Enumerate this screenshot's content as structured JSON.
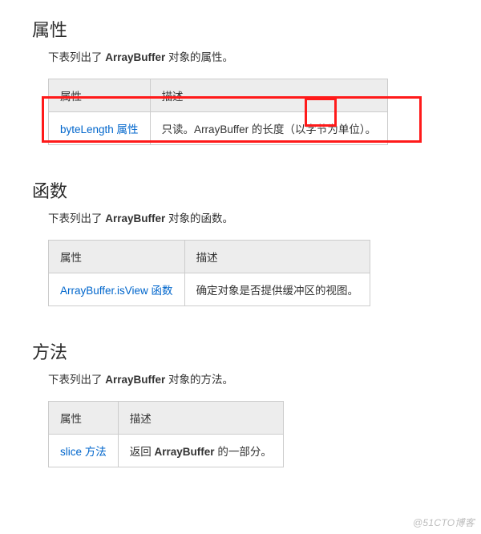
{
  "sections": {
    "properties": {
      "heading": "属性",
      "desc_prefix": "下表列出了 ",
      "desc_bold": "ArrayBuffer",
      "desc_suffix": " 对象的属性。",
      "table": {
        "headers": {
          "col1": "属性",
          "col2": "描述"
        },
        "row": {
          "name": "byteLength 属性",
          "desc": "只读。ArrayBuffer 的长度（以字节为单位）。"
        }
      }
    },
    "functions": {
      "heading": "函数",
      "desc_prefix": "下表列出了 ",
      "desc_bold": "ArrayBuffer",
      "desc_suffix": " 对象的函数。",
      "table": {
        "headers": {
          "col1": "属性",
          "col2": "描述"
        },
        "row": {
          "name": "ArrayBuffer.isView 函数",
          "desc": "确定对象是否提供缓冲区的视图。"
        }
      }
    },
    "methods": {
      "heading": "方法",
      "desc_prefix": "下表列出了 ",
      "desc_bold": "ArrayBuffer",
      "desc_suffix": " 对象的方法。",
      "table": {
        "headers": {
          "col1": "属性",
          "col2": "描述"
        },
        "row": {
          "name": "slice 方法",
          "desc_prefix": "返回 ",
          "desc_bold": "ArrayBuffer",
          "desc_suffix": " 的一部分。"
        }
      }
    }
  },
  "watermark": "@51CTO博客"
}
